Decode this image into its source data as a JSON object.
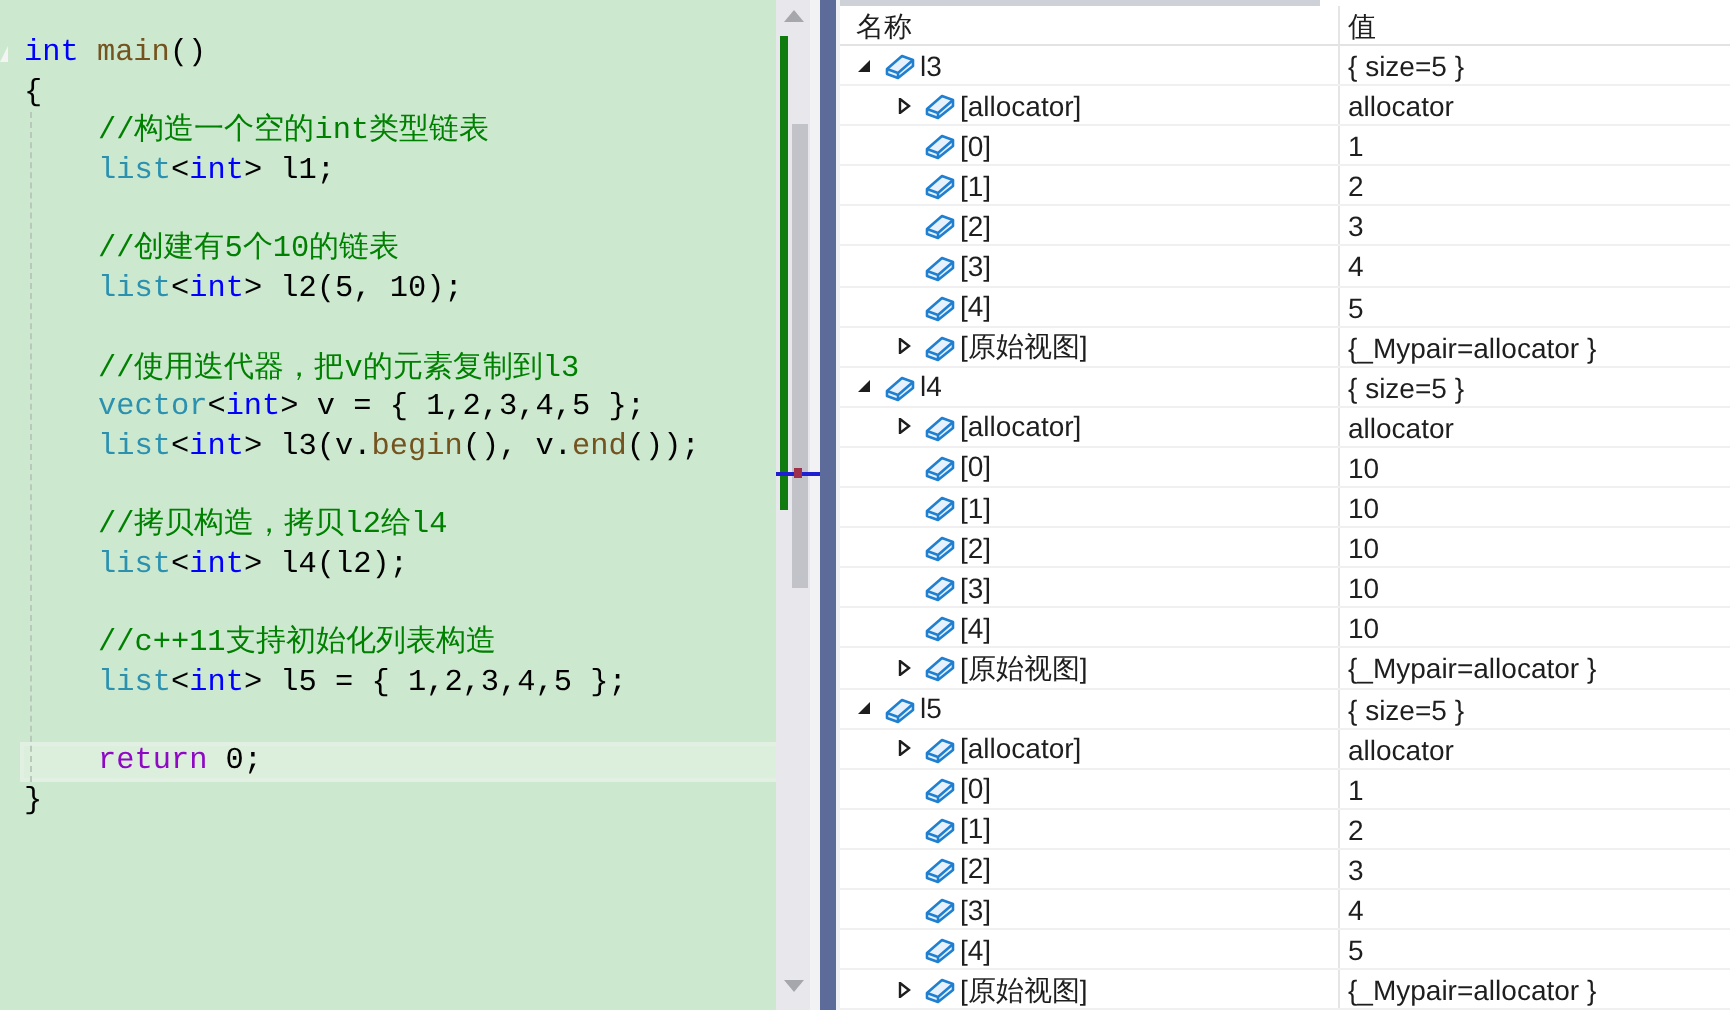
{
  "editor": {
    "lines": [
      {
        "kind": "code",
        "current": false,
        "tokens": [
          {
            "kind": "keyword",
            "text": "int"
          },
          {
            "kind": "function",
            "text": " main"
          },
          {
            "kind": "plain",
            "text": "()"
          }
        ]
      },
      {
        "kind": "code",
        "current": false,
        "tokens": [
          {
            "kind": "plain",
            "text": "{"
          }
        ]
      },
      {
        "kind": "block",
        "children": [
          {
            "kind": "code",
            "current": false,
            "tokens": [
              {
                "kind": "comment",
                "text": "//构造一个空的int类型链表"
              }
            ]
          },
          {
            "kind": "code",
            "current": false,
            "tokens": [
              {
                "kind": "type",
                "text": "list"
              },
              {
                "kind": "plain",
                "text": "<"
              },
              {
                "kind": "keyword",
                "text": "int"
              },
              {
                "kind": "plain",
                "text": "> l1;"
              }
            ]
          },
          {
            "kind": "blank",
            "current": false
          },
          {
            "kind": "code",
            "current": false,
            "tokens": [
              {
                "kind": "comment",
                "text": "//创建有5个10的链表"
              }
            ]
          },
          {
            "kind": "code",
            "current": false,
            "tokens": [
              {
                "kind": "type",
                "text": "list"
              },
              {
                "kind": "plain",
                "text": "<"
              },
              {
                "kind": "keyword",
                "text": "int"
              },
              {
                "kind": "plain",
                "text": "> l2(5, 10);"
              }
            ]
          },
          {
            "kind": "blank",
            "current": false
          },
          {
            "kind": "code",
            "current": false,
            "tokens": [
              {
                "kind": "comment",
                "text": "//使用迭代器，把v的元素复制到l3"
              }
            ]
          },
          {
            "kind": "code",
            "current": false,
            "tokens": [
              {
                "kind": "type",
                "text": "vector"
              },
              {
                "kind": "plain",
                "text": "<"
              },
              {
                "kind": "keyword",
                "text": "int"
              },
              {
                "kind": "plain",
                "text": "> v = { 1,2,3,4,5 };"
              }
            ]
          },
          {
            "kind": "code",
            "current": false,
            "tokens": [
              {
                "kind": "type",
                "text": "list"
              },
              {
                "kind": "plain",
                "text": "<"
              },
              {
                "kind": "keyword",
                "text": "int"
              },
              {
                "kind": "plain",
                "text": "> l3(v."
              },
              {
                "kind": "function",
                "text": "begin"
              },
              {
                "kind": "plain",
                "text": "(), v."
              },
              {
                "kind": "function",
                "text": "end"
              },
              {
                "kind": "plain",
                "text": "());"
              }
            ]
          },
          {
            "kind": "blank",
            "current": false
          },
          {
            "kind": "code",
            "current": false,
            "tokens": [
              {
                "kind": "comment",
                "text": "//拷贝构造，拷贝l2给l4"
              }
            ]
          },
          {
            "kind": "code",
            "current": false,
            "tokens": [
              {
                "kind": "type",
                "text": "list"
              },
              {
                "kind": "plain",
                "text": "<"
              },
              {
                "kind": "keyword",
                "text": "int"
              },
              {
                "kind": "plain",
                "text": "> l4(l2);"
              }
            ]
          },
          {
            "kind": "blank",
            "current": false
          },
          {
            "kind": "code",
            "current": false,
            "tokens": [
              {
                "kind": "comment",
                "text": "//c++11支持初始化列表构造"
              }
            ]
          },
          {
            "kind": "code",
            "current": false,
            "tokens": [
              {
                "kind": "type",
                "text": "list"
              },
              {
                "kind": "plain",
                "text": "<"
              },
              {
                "kind": "keyword",
                "text": "int"
              },
              {
                "kind": "plain",
                "text": "> l5 = { 1,2,3,4,5 };"
              }
            ]
          },
          {
            "kind": "blank",
            "current": false
          },
          {
            "kind": "code",
            "current": true,
            "tokens": [
              {
                "kind": "control",
                "text": "return"
              },
              {
                "kind": "plain",
                "text": " 0;"
              }
            ]
          }
        ]
      },
      {
        "kind": "code",
        "current": false,
        "tokens": [
          {
            "kind": "plain",
            "text": "}"
          }
        ]
      }
    ]
  },
  "watch": {
    "columns": [
      "名称",
      "值"
    ],
    "rows": [
      {
        "kind": "group",
        "name": "l3",
        "value": "{ size=5 }",
        "expanded": true,
        "children": [
          {
            "kind": "group",
            "name": "[allocator]",
            "value": "allocator",
            "expanded": false
          },
          {
            "kind": "item",
            "name": "[0]",
            "value": "1"
          },
          {
            "kind": "item",
            "name": "[1]",
            "value": "2"
          },
          {
            "kind": "item",
            "name": "[2]",
            "value": "3"
          },
          {
            "kind": "item",
            "name": "[3]",
            "value": "4"
          },
          {
            "kind": "item",
            "name": "[4]",
            "value": "5"
          },
          {
            "kind": "group",
            "name": "[原始视图]",
            "value": "{_Mypair=allocator }",
            "expanded": false
          }
        ]
      },
      {
        "kind": "group",
        "name": "l4",
        "value": "{ size=5 }",
        "expanded": true,
        "children": [
          {
            "kind": "group",
            "name": "[allocator]",
            "value": "allocator",
            "expanded": false
          },
          {
            "kind": "item",
            "name": "[0]",
            "value": "10"
          },
          {
            "kind": "item",
            "name": "[1]",
            "value": "10"
          },
          {
            "kind": "item",
            "name": "[2]",
            "value": "10"
          },
          {
            "kind": "item",
            "name": "[3]",
            "value": "10"
          },
          {
            "kind": "item",
            "name": "[4]",
            "value": "10"
          },
          {
            "kind": "group",
            "name": "[原始视图]",
            "value": "{_Mypair=allocator }",
            "expanded": false
          }
        ]
      },
      {
        "kind": "group",
        "name": "l5",
        "value": "{ size=5 }",
        "expanded": true,
        "children": [
          {
            "kind": "group",
            "name": "[allocator]",
            "value": "allocator",
            "expanded": false
          },
          {
            "kind": "item",
            "name": "[0]",
            "value": "1"
          },
          {
            "kind": "item",
            "name": "[1]",
            "value": "2"
          },
          {
            "kind": "item",
            "name": "[2]",
            "value": "3"
          },
          {
            "kind": "item",
            "name": "[3]",
            "value": "4"
          },
          {
            "kind": "item",
            "name": "[4]",
            "value": "5"
          },
          {
            "kind": "group",
            "name": "[原始视图]",
            "value": "{_Mypair=allocator }",
            "expanded": false
          }
        ]
      }
    ]
  }
}
